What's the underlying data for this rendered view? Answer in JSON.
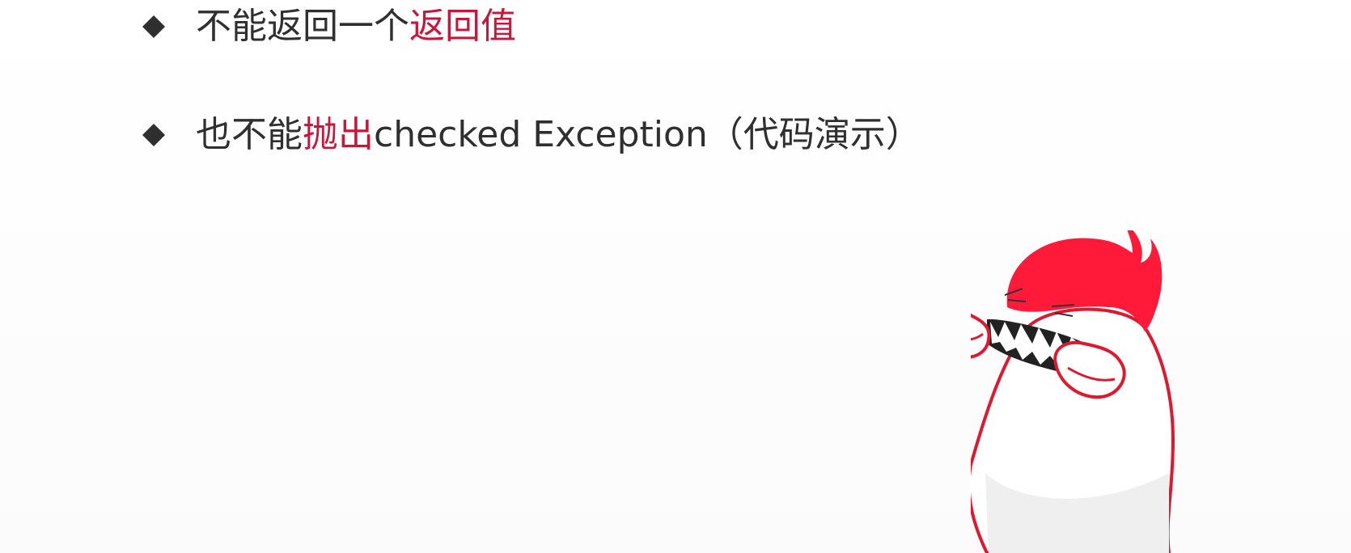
{
  "slide": {
    "bullets": [
      {
        "parts": [
          {
            "text": "不能返回一个",
            "accent": false
          },
          {
            "text": "返回值",
            "accent": true
          }
        ]
      },
      {
        "parts": [
          {
            "text": "也不能",
            "accent": false
          },
          {
            "text": "抛出",
            "accent": true
          },
          {
            "text": "checked Exception（代码演示）",
            "accent": false
          }
        ]
      }
    ],
    "bullet_icon": "diamond-icon",
    "mascot": "red-haired-monster-mascot"
  },
  "colors": {
    "text": "#2f2f2f",
    "accent": "#c8173c",
    "mascot_hair": "#ff1a3a",
    "mascot_outline": "#e0182f"
  }
}
